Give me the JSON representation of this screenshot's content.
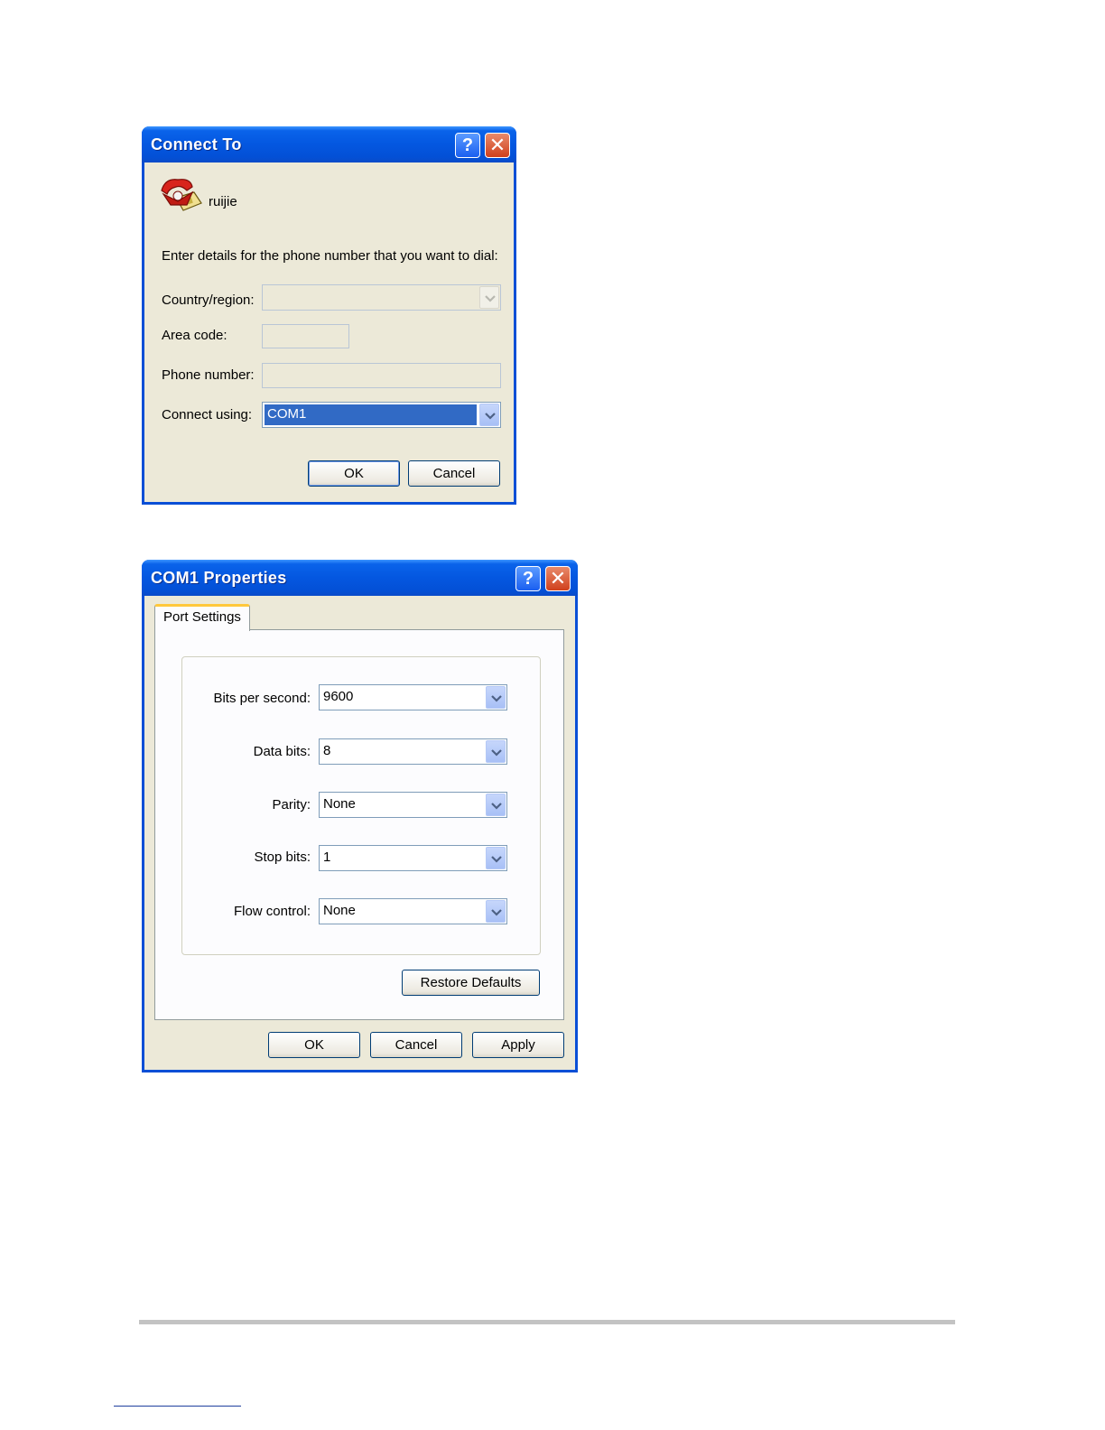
{
  "connect_dialog": {
    "title": "Connect To",
    "connection_name": "ruijie",
    "prompt": "Enter details for the phone number that you want to dial:",
    "country_label": "Country/region:",
    "country_value": "",
    "area_label": "Area code:",
    "area_value": "",
    "phone_label": "Phone number:",
    "phone_value": "",
    "connect_using_label": "Connect using:",
    "connect_using_value": "COM1",
    "ok_label": "OK",
    "cancel_label": "Cancel",
    "help_glyph": "?",
    "close_glyph": "✕"
  },
  "com_dialog": {
    "title": "COM1 Properties",
    "tab_label": "Port Settings",
    "bps_label": "Bits per second:",
    "bps_value": "9600",
    "data_bits_label": "Data bits:",
    "data_bits_value": "8",
    "parity_label": "Parity:",
    "parity_value": "None",
    "stop_bits_label": "Stop bits:",
    "stop_bits_value": "1",
    "flow_label": "Flow control:",
    "flow_value": "None",
    "restore_label": "Restore Defaults",
    "ok_label": "OK",
    "cancel_label": "Cancel",
    "apply_label": "Apply",
    "help_glyph": "?",
    "close_glyph": "✕"
  },
  "icons": {
    "connection": "red-telephone-icon",
    "dropdown": "chevron-down-icon"
  },
  "colors": {
    "title_bar": "#0457e0",
    "window_face": "#ece9d8",
    "selection": "#316ac5",
    "tab_highlight": "#ffc83c"
  }
}
